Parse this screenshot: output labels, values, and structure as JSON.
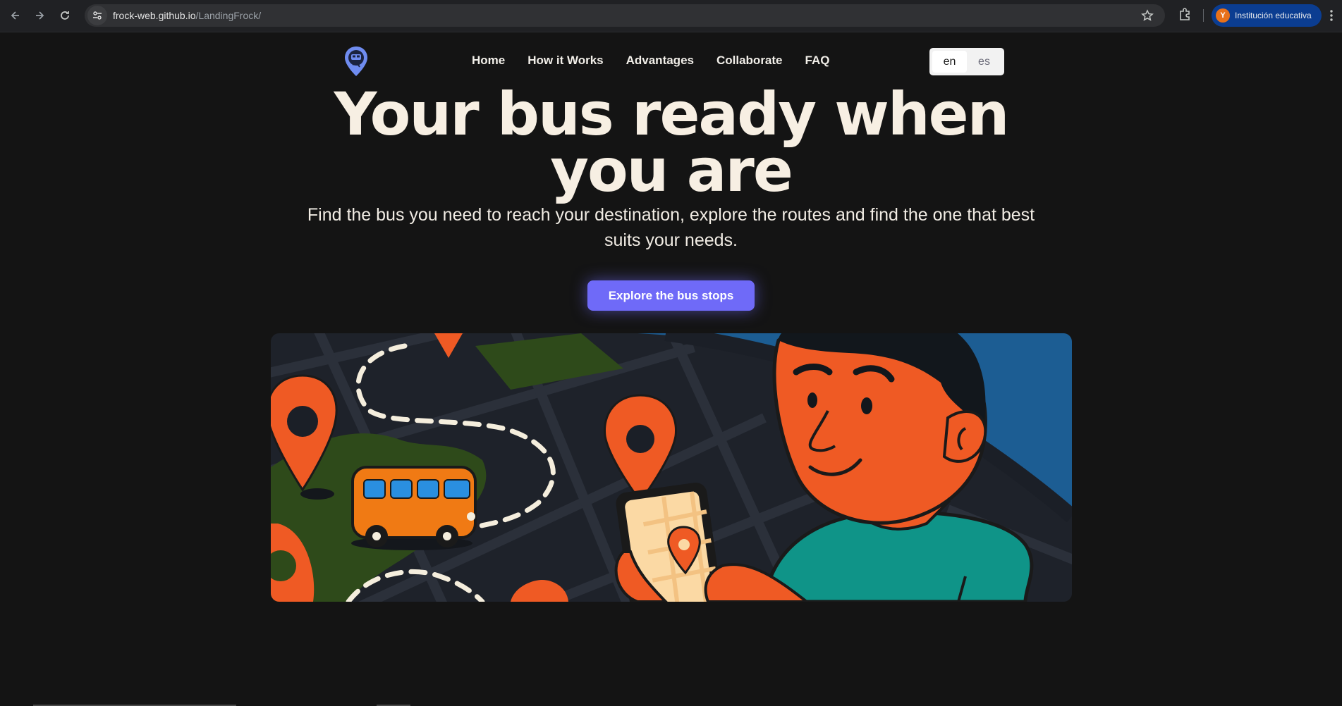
{
  "browser": {
    "url_domain": "frock-web.github.io",
    "url_path": "/LandingFrock/",
    "profile_initial": "Y",
    "profile_name": "Institución educativa"
  },
  "nav": {
    "items": [
      {
        "label": "Home"
      },
      {
        "label": "How it Works"
      },
      {
        "label": "Advantages"
      },
      {
        "label": "Collaborate"
      },
      {
        "label": "FAQ"
      }
    ]
  },
  "language": {
    "options": [
      "en",
      "es"
    ],
    "selected": "en"
  },
  "hero": {
    "title_line1": "Your bus ready when",
    "title_line2": "you are",
    "subtitle_line1": "Find the bus you need to reach your destination, explore the routes and find the one that best",
    "subtitle_line2": "suits your needs.",
    "cta_label": "Explore the bus stops"
  },
  "colors": {
    "page_bg": "#141414",
    "cta": "#6f6af8",
    "pin": "#ef5a24",
    "bus": "#f07a14",
    "shirt": "#0f9488",
    "logo": "#6f8cf0"
  }
}
